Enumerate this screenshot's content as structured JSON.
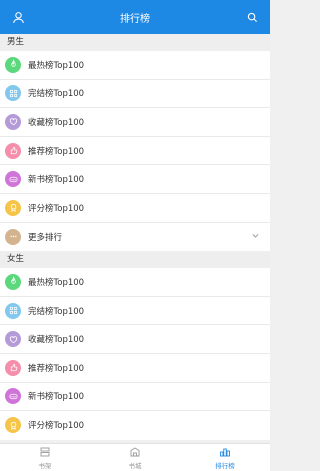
{
  "header": {
    "title": "排行榜",
    "user_icon": "user-icon",
    "search_icon": "search-icon"
  },
  "sections": [
    {
      "label": "男生",
      "items": [
        {
          "label": "最热榜Top100",
          "icon": "flame-icon",
          "color": "#5cd87c"
        },
        {
          "label": "完结榜Top100",
          "icon": "grid-icon",
          "color": "#82c8ee"
        },
        {
          "label": "收藏榜Top100",
          "icon": "heart-icon",
          "color": "#b59ad8"
        },
        {
          "label": "推荐榜Top100",
          "icon": "thumbs-up-icon",
          "color": "#f48eaa"
        },
        {
          "label": "新书榜Top100",
          "icon": "new-icon",
          "color": "#cf74d9"
        },
        {
          "label": "评分榜Top100",
          "icon": "medal-icon",
          "color": "#f5c54a"
        },
        {
          "label": "更多排行",
          "icon": "more-icon",
          "color": "#d3b48f",
          "expandable": true
        }
      ]
    },
    {
      "label": "女生",
      "items": [
        {
          "label": "最热榜Top100",
          "icon": "flame-icon",
          "color": "#5cd87c"
        },
        {
          "label": "完结榜Top100",
          "icon": "grid-icon",
          "color": "#82c8ee"
        },
        {
          "label": "收藏榜Top100",
          "icon": "heart-icon",
          "color": "#b59ad8"
        },
        {
          "label": "推荐榜Top100",
          "icon": "thumbs-up-icon",
          "color": "#f48eaa"
        },
        {
          "label": "新书榜Top100",
          "icon": "new-icon",
          "color": "#cf74d9"
        },
        {
          "label": "评分榜Top100",
          "icon": "medal-icon",
          "color": "#f5c54a"
        }
      ]
    }
  ],
  "tabs": [
    {
      "label": "书架",
      "icon": "bookshelf-icon",
      "active": false
    },
    {
      "label": "书城",
      "icon": "bookstore-icon",
      "active": false
    },
    {
      "label": "排行榜",
      "icon": "ranking-icon",
      "active": true
    }
  ],
  "colors": {
    "accent": "#1e88e5",
    "tab_inactive": "#999999"
  }
}
